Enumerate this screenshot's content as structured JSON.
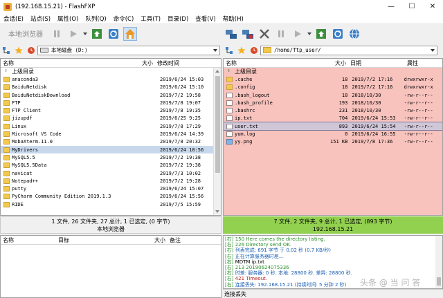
{
  "window": {
    "title": "(192.168.15.21) - FlashFXP",
    "min": "—",
    "max": "☐",
    "close": "✕"
  },
  "menu": [
    "会话(E)",
    "站点(S)",
    "属性(O)",
    "队列(Q)",
    "命令(C)",
    "工具(T)",
    "目录(D)",
    "查看(V)",
    "帮助(H)"
  ],
  "local": {
    "toolbar_label": "本地浏览器",
    "path": "本地磁盘 (D:)",
    "columns": {
      "name": "名称",
      "size": "大小",
      "modified": "修改时间"
    },
    "up_label": "上级目录",
    "rows": [
      {
        "name": "anaconda3",
        "size": "",
        "date": "2019/6/24 15:03",
        "type": "folder"
      },
      {
        "name": "BaiduNetdisk",
        "size": "",
        "date": "2019/6/24 15:10",
        "type": "folder"
      },
      {
        "name": "BaiduNetdiskDownload",
        "size": "",
        "date": "2019/7/2 19:58",
        "type": "folder"
      },
      {
        "name": "FTP",
        "size": "",
        "date": "2019/7/8 19:07",
        "type": "folder"
      },
      {
        "name": "FTP Client",
        "size": "",
        "date": "2019/7/8 19:35",
        "type": "folder"
      },
      {
        "name": "jizupdf",
        "size": "",
        "date": "2019/6/25 9:25",
        "type": "folder"
      },
      {
        "name": "Linux",
        "size": "",
        "date": "2019/7/8 17:29",
        "type": "folder"
      },
      {
        "name": "Microsoft VS Code",
        "size": "",
        "date": "2019/6/24 14:39",
        "type": "folder"
      },
      {
        "name": "MobaXterm.11.0",
        "size": "",
        "date": "2019/7/8 20:32",
        "type": "folder"
      },
      {
        "name": "MyDrivers",
        "size": "",
        "date": "2019/6/24 10:56",
        "type": "folder",
        "selected": true
      },
      {
        "name": "MySQL5.5",
        "size": "",
        "date": "2019/7/2 19:38",
        "type": "folder"
      },
      {
        "name": "MySQL5.5Data",
        "size": "",
        "date": "2019/7/2 19:38",
        "type": "folder"
      },
      {
        "name": "navicat",
        "size": "",
        "date": "2019/7/3 10:02",
        "type": "folder"
      },
      {
        "name": "Notepad++",
        "size": "",
        "date": "2019/7/2 19:28",
        "type": "folder"
      },
      {
        "name": "putty",
        "size": "",
        "date": "2019/6/24 15:07",
        "type": "folder"
      },
      {
        "name": "PyCharm Community Edition 2019.1.3",
        "size": "",
        "date": "2019/6/24 15:56",
        "type": "folder"
      },
      {
        "name": "RIDE",
        "size": "",
        "date": "2019/7/5 15:59",
        "type": "folder"
      }
    ],
    "status_line1": "1 文件, 26 文件夹, 27 总计, 1 已选定, (0 字节)",
    "status_line2": "本地浏览器"
  },
  "remote": {
    "path": "/home/ftp_user/",
    "columns": {
      "name": "名称",
      "size": "大小",
      "date": "日期",
      "attr": "属性"
    },
    "up_label": "上级目录",
    "rows": [
      {
        "name": ".cache",
        "size": "18",
        "date": "2019/7/2 17:16",
        "attr": "drwxrwxr-x",
        "type": "folder"
      },
      {
        "name": ".config",
        "size": "18",
        "date": "2019/7/2 17:16",
        "attr": "drwxrwxr-x",
        "type": "folder"
      },
      {
        "name": ".bash_logout",
        "size": "18",
        "date": "2018/10/30",
        "attr": "-rw-r--r--",
        "type": "file"
      },
      {
        "name": ".bash_profile",
        "size": "193",
        "date": "2018/10/30",
        "attr": "-rw-r--r--",
        "type": "file"
      },
      {
        "name": ".bashrc",
        "size": "231",
        "date": "2018/10/30",
        "attr": "-rw-r--r--",
        "type": "file"
      },
      {
        "name": "ip.txt",
        "size": "704",
        "date": "2019/6/24 15:53",
        "attr": "-rw-r--r--",
        "type": "file"
      },
      {
        "name": "user.txt",
        "size": "893",
        "date": "2019/6/24 15:54",
        "attr": "-rw-r--r--",
        "type": "file",
        "selected": true
      },
      {
        "name": "yum.log",
        "size": "0",
        "date": "2019/6/24 16:55",
        "attr": "-rw-r--r--",
        "type": "file"
      },
      {
        "name": "yy.png",
        "size": "151 KB",
        "date": "2019/7/8 17:36",
        "attr": "-rw-r--r--",
        "type": "img"
      }
    ],
    "status_line1": "7 文件, 2 文件夹, 9 总计, 1 已选定, (893 字节)",
    "status_line2": "192.168.15.21"
  },
  "queue": {
    "columns": {
      "name": "名称",
      "target": "目标",
      "size": "大小",
      "note": "备注"
    }
  },
  "log": [
    {
      "tag": "[右]",
      "text": "150 Here comes the directory listing.",
      "kind": "resp"
    },
    {
      "tag": "[右]",
      "text": "226 Directory send OK.",
      "kind": "resp"
    },
    {
      "tag": "[右]",
      "text": "列表完成: 691 字节 于 0.02 秒 (0.7 KB/秒)",
      "kind": "info"
    },
    {
      "tag": "[右]",
      "text": "正在计算服务器时差...",
      "kind": "info"
    },
    {
      "tag": "[右]",
      "text": "MDTM ip.txt",
      "kind": "cmd"
    },
    {
      "tag": "[右]",
      "text": "213 20190624075336",
      "kind": "resp"
    },
    {
      "tag": "[右]",
      "text": "时差: 服务器: 0 秒. 本地: 28800 秒. 差异: 28800 秒.",
      "kind": "info"
    },
    {
      "tag": "[右]",
      "text": "421 Timeout.",
      "kind": "err"
    },
    {
      "tag": "[右]",
      "text": "连接丢失: 192.168.15.21 (持续时间: 5 分钟 2 秒)",
      "kind": "info"
    }
  ],
  "bottom_status": "连接丢失",
  "watermark": "头条 @ 当 问 答"
}
